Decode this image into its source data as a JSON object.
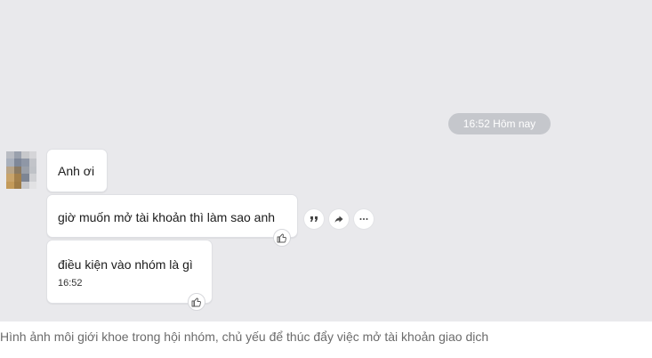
{
  "chat": {
    "time_pill": "16:52 Hôm nay",
    "messages": [
      {
        "text": "Anh ơi"
      },
      {
        "text": "giờ muốn mở tài khoản thì làm sao anh"
      },
      {
        "text": "điều kiện vào nhóm là gì",
        "time": "16:52"
      }
    ],
    "icons": {
      "quote": "quote-icon",
      "share": "share-icon",
      "more": "more-icon",
      "like": "thumbs-up-icon",
      "avatar": "blurred-avatar"
    },
    "colors": {
      "chat_background": "#e9e9ec",
      "bubble": "#ffffff",
      "time_pill": "#c5c7cc",
      "caption_text": "#6b6b6b"
    }
  },
  "caption": "Hình ảnh môi giới khoe trong hội nhóm, chủ yếu để thúc đẩy việc mở tài khoản giao dịch"
}
